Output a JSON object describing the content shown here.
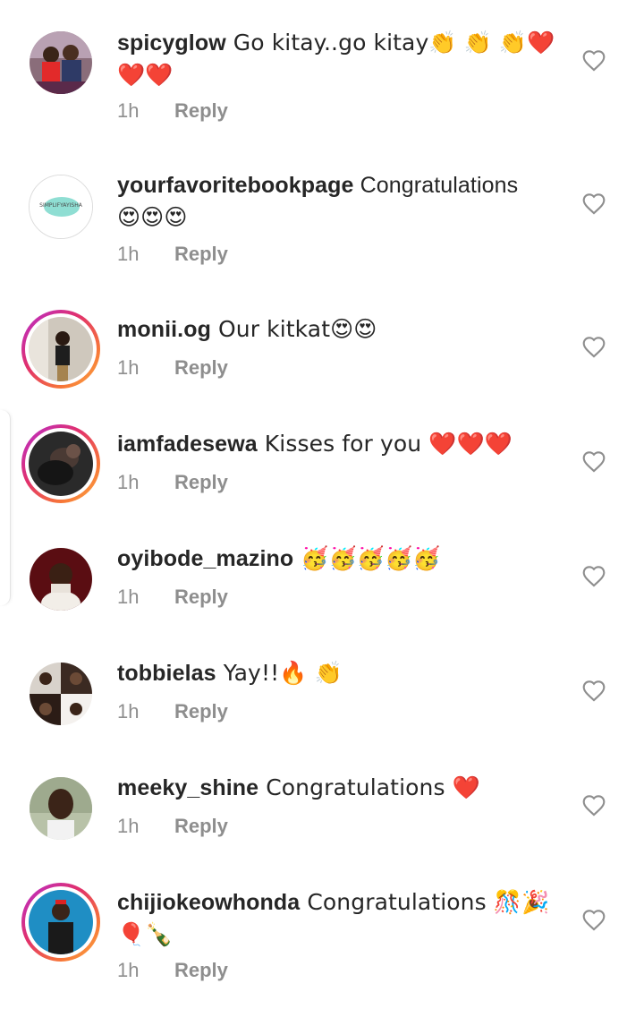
{
  "comments": [
    {
      "username": "spicyglow",
      "text": " Go kitay..go kitay👏 👏 👏❤️",
      "text2": "❤️❤️",
      "time": "1h",
      "reply": "Reply",
      "ring": false
    },
    {
      "username": "yourfavoritebookpage",
      "text": " Congratulations",
      "text2": "😍😍😍",
      "time": "1h",
      "reply": "Reply",
      "ring": false,
      "avatar_text": "SIMPLIFYAYISHA"
    },
    {
      "username": "monii.og",
      "text": " Our kitkat😍😍",
      "time": "1h",
      "reply": "Reply",
      "ring": true
    },
    {
      "username": "iamfadesewa",
      "text": " Kisses for you ❤️❤️❤️",
      "time": "1h",
      "reply": "Reply",
      "ring": true
    },
    {
      "username": "oyibode_mazino",
      "text": " 🥳🥳🥳🥳🥳",
      "time": "1h",
      "reply": "Reply",
      "ring": false
    },
    {
      "username": "tobbielas",
      "text": " Yay!!🔥 👏",
      "time": "1h",
      "reply": "Reply",
      "ring": false
    },
    {
      "username": "meeky_shine",
      "text": " Congratulations ❤️",
      "time": "1h",
      "reply": "Reply",
      "ring": false
    },
    {
      "username": "chijiokeowhonda",
      "text": " Congratulations 🎊🎉",
      "text2": "🎈🍾",
      "time": "1h",
      "reply": "Reply",
      "ring": true
    }
  ],
  "colors": {
    "text": "#262626",
    "meta": "#8e8e8e",
    "heart_outline": "#8e8e8e",
    "story_ring_start": "#b52ed0",
    "story_ring_end": "#fcaf45"
  },
  "icons": {
    "like": "heart-outline-icon"
  }
}
